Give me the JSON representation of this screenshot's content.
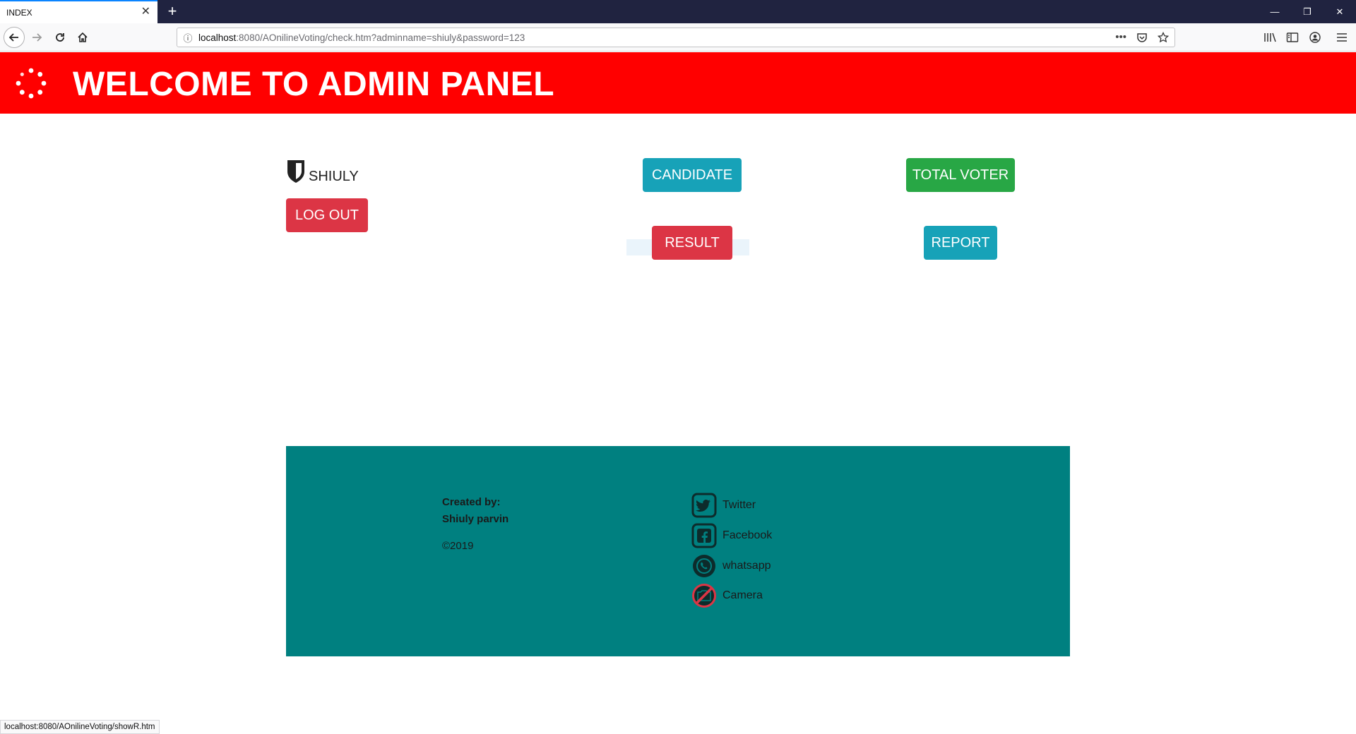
{
  "browser": {
    "tab_title": "INDEX",
    "url_host": "localhost",
    "url_path": ":8080/AOnilineVoting/check.htm?adminname=shiuly&password=123",
    "status_url": "localhost:8080/AOnilineVoting/showR.htm",
    "more_label": "•••"
  },
  "header": {
    "title": "WELCOME TO ADMIN PANEL",
    "color": "#ff0000"
  },
  "user": {
    "name": "SHIULY",
    "logout_label": "LOG OUT"
  },
  "actions": {
    "candidate_label": "CANDIDATE",
    "total_voter_label": "TOTAL VOTER",
    "result_label": "RESULT",
    "report_label": "REPORT"
  },
  "footer": {
    "created_by_label": "Created by:",
    "author": "Shiuly parvin",
    "copyright": "©2019",
    "background": "#008080",
    "links": [
      {
        "label": "Twitter",
        "icon": "twitter-icon"
      },
      {
        "label": "Facebook",
        "icon": "facebook-icon"
      },
      {
        "label": "whatsapp",
        "icon": "whatsapp-icon"
      },
      {
        "label": "Camera",
        "icon": "camera-off-icon"
      }
    ]
  }
}
